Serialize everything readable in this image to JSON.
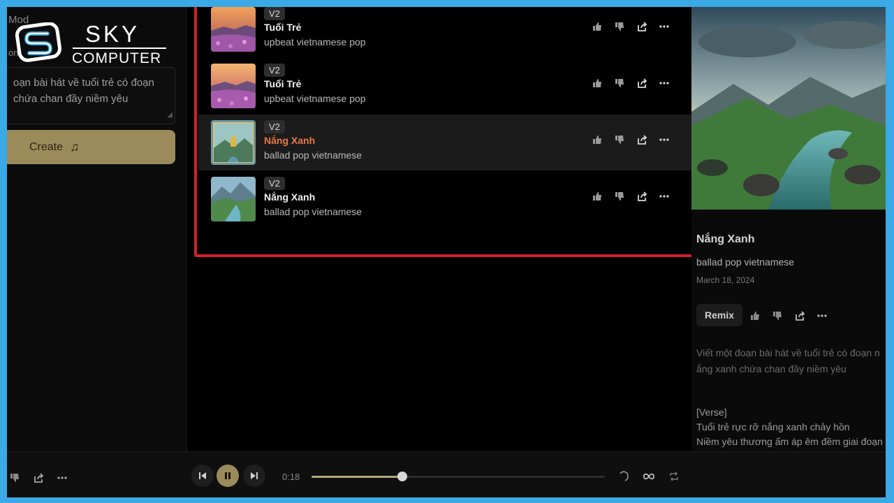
{
  "left_panel": {
    "fragment_top": "Mod",
    "fragment_small": "on",
    "prompt_text": "oạn bài hát về tuổi trẻ có đoạn chứa chan đầy niềm yêu",
    "create_label": "Create"
  },
  "logo": {
    "brand": "SKY",
    "sub": "COMPUTER"
  },
  "songs": [
    {
      "version": "V2",
      "title": "Tuổi Trẻ",
      "style": "upbeat vietnamese pop",
      "active": false
    },
    {
      "version": "V2",
      "title": "Tuổi Trẻ",
      "style": "upbeat vietnamese pop",
      "active": false
    },
    {
      "version": "V2",
      "title": "Nắng Xanh",
      "style": "ballad pop vietnamese",
      "active": true
    },
    {
      "version": "V2",
      "title": "Nắng Xanh",
      "style": "ballad pop vietnamese",
      "active": false
    }
  ],
  "detail": {
    "title": "Nắng Xanh",
    "style": "ballad pop vietnamese",
    "date": "March 18, 2024",
    "remix_label": "Remix",
    "prompt_line1": "Viết một đoạn bài hát về tuổi trẻ có đoạn n",
    "prompt_line2": "ắng xanh chứa chan đầy niềm yêu",
    "lyrics": [
      "[Verse]",
      "Tuổi trẻ rực rỡ nắng xanh chảy hồn",
      "Niềm yêu thương ấm áp êm đềm giai đoạn"
    ]
  },
  "player": {
    "elapsed": "0:18",
    "progress": 0.31
  },
  "colors": {
    "accent": "#9b8a5a",
    "highlight": "#e57b45",
    "frame": "#3aa9e6",
    "border_red": "#d1202a"
  }
}
